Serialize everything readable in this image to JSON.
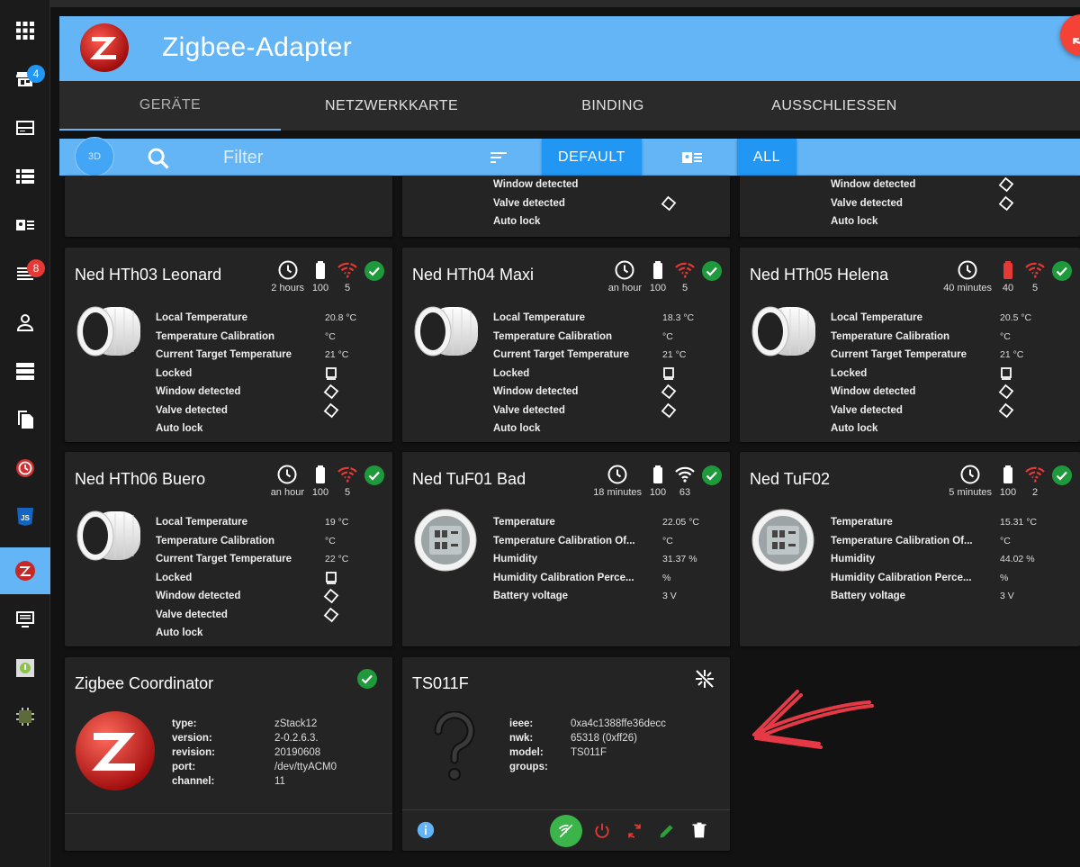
{
  "sidebar": {
    "badges": {
      "store": "4",
      "list": "8"
    }
  },
  "header": {
    "title": "Zigbee-Adapter"
  },
  "tabs": [
    "GERÄTE",
    "NETZWERKKARTE",
    "BINDING",
    "AUSSCHLIESSEN"
  ],
  "filterbar": {
    "btn_3d": "3D",
    "placeholder": "Filter",
    "default_label": "DEFAULT",
    "all_label": "ALL"
  },
  "top_cards": [
    {
      "props": []
    },
    {
      "props": [
        {
          "label": "Window detected",
          "value": ""
        },
        {
          "label": "Valve detected",
          "value": ""
        },
        {
          "label": "Auto lock",
          "value": ""
        }
      ]
    },
    {
      "props": [
        {
          "label": "Window detected",
          "value": ""
        },
        {
          "label": "Valve detected",
          "value": ""
        },
        {
          "label": "Auto lock",
          "value": ""
        }
      ]
    }
  ],
  "devices": [
    {
      "name": "Ned HTh03 Leonard",
      "last_seen": "2 hours",
      "battery": "100",
      "link": "5",
      "props": [
        {
          "label": "Local Temperature",
          "value": "20.8 °C"
        },
        {
          "label": "Temperature Calibration",
          "value": "°C"
        },
        {
          "label": "Current Target Temperature",
          "value": "21 °C"
        },
        {
          "label": "Locked",
          "value": ""
        },
        {
          "label": "Window detected",
          "value": ""
        },
        {
          "label": "Valve detected",
          "value": ""
        },
        {
          "label": "Auto lock",
          "value": ""
        }
      ]
    },
    {
      "name": "Ned HTh04 Maxi",
      "last_seen": "an hour",
      "battery": "100",
      "link": "5",
      "props": [
        {
          "label": "Local Temperature",
          "value": "18.3 °C"
        },
        {
          "label": "Temperature Calibration",
          "value": "°C"
        },
        {
          "label": "Current Target Temperature",
          "value": "21 °C"
        },
        {
          "label": "Locked",
          "value": ""
        },
        {
          "label": "Window detected",
          "value": ""
        },
        {
          "label": "Valve detected",
          "value": ""
        },
        {
          "label": "Auto lock",
          "value": ""
        }
      ]
    },
    {
      "name": "Ned HTh05 Helena",
      "last_seen": "40 minutes",
      "battery": "40",
      "link": "5",
      "props": [
        {
          "label": "Local Temperature",
          "value": "20.5 °C"
        },
        {
          "label": "Temperature Calibration",
          "value": "°C"
        },
        {
          "label": "Current Target Temperature",
          "value": "21 °C"
        },
        {
          "label": "Locked",
          "value": ""
        },
        {
          "label": "Window detected",
          "value": ""
        },
        {
          "label": "Valve detected",
          "value": ""
        },
        {
          "label": "Auto lock",
          "value": ""
        }
      ]
    },
    {
      "name": "Ned HTh06 Buero",
      "last_seen": "an hour",
      "battery": "100",
      "link": "5",
      "props": [
        {
          "label": "Local Temperature",
          "value": "19 °C"
        },
        {
          "label": "Temperature Calibration",
          "value": "°C"
        },
        {
          "label": "Current Target Temperature",
          "value": "22 °C"
        },
        {
          "label": "Locked",
          "value": ""
        },
        {
          "label": "Window detected",
          "value": ""
        },
        {
          "label": "Valve detected",
          "value": ""
        },
        {
          "label": "Auto lock",
          "value": ""
        }
      ]
    },
    {
      "name": "Ned TuF01 Bad",
      "last_seen": "18 minutes",
      "battery": "100",
      "link": "63",
      "props": [
        {
          "label": "Temperature",
          "value": "22.05 °C"
        },
        {
          "label": "Temperature Calibration Of...",
          "value": "°C"
        },
        {
          "label": "Humidity",
          "value": "31.37 %"
        },
        {
          "label": "Humidity Calibration Perce...",
          "value": "%"
        },
        {
          "label": "Battery voltage",
          "value": "3 V"
        }
      ]
    },
    {
      "name": "Ned TuF02",
      "last_seen": "5 minutes",
      "battery": "100",
      "link": "2",
      "props": [
        {
          "label": "Temperature",
          "value": "15.31 °C"
        },
        {
          "label": "Temperature Calibration Of...",
          "value": "°C"
        },
        {
          "label": "Humidity",
          "value": "44.02 %"
        },
        {
          "label": "Humidity Calibration Perce...",
          "value": "%"
        },
        {
          "label": "Battery voltage",
          "value": "3 V"
        }
      ]
    }
  ],
  "coordinator": {
    "name": "Zigbee Coordinator",
    "rows": [
      {
        "k": "type:",
        "v": "zStack12"
      },
      {
        "k": "version:",
        "v": "2-0.2.6.3."
      },
      {
        "k": "revision:",
        "v": "20190608"
      },
      {
        "k": "port:",
        "v": "/dev/ttyACM0"
      },
      {
        "k": "channel:",
        "v": "11"
      }
    ]
  },
  "ts011f": {
    "name": "TS011F",
    "rows": [
      {
        "k": "ieee:",
        "v": "0xa4c1388ffe36decc"
      },
      {
        "k": "nwk:",
        "v": "65318 (0xff26)"
      },
      {
        "k": "model:",
        "v": "TS011F"
      },
      {
        "k": "groups:",
        "v": ""
      }
    ]
  },
  "colors": {
    "header": "#64b5f6",
    "accent": "#2196f3",
    "ok": "#1e9a3c",
    "danger": "#e53935",
    "card": "#242424"
  }
}
